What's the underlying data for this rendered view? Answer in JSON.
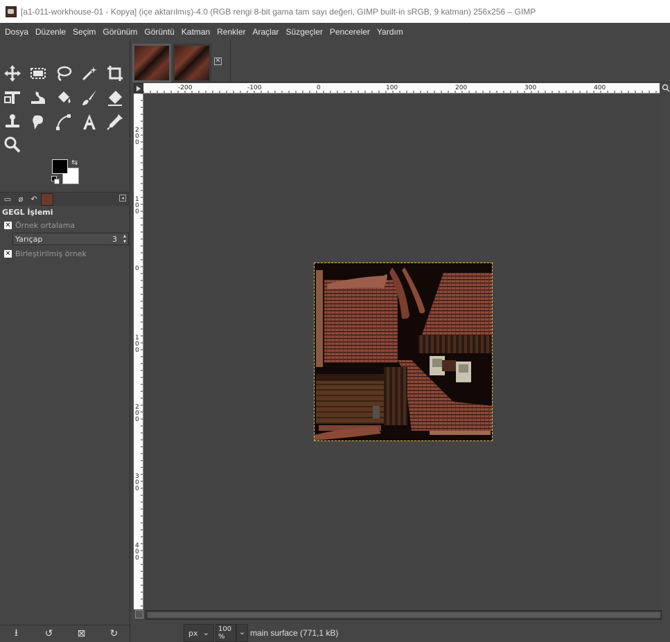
{
  "titlebar": {
    "title": "[a1-011-workhouse-01 - Kopya] (içe aktarılmış)-4.0 (RGB rengi 8-bit gama tam sayı değeri, GIMP built-in sRGB, 9 katman) 256x256 – GIMP"
  },
  "menubar": {
    "items": [
      "Dosya",
      "Düzenle",
      "Seçim",
      "Görünüm",
      "Görüntü",
      "Katman",
      "Renkler",
      "Araçlar",
      "Süzgeçler",
      "Pencereler",
      "Yardım"
    ]
  },
  "toolbox": {
    "tools": [
      "move-icon",
      "rect-select-icon",
      "lasso-icon",
      "fuzzy-select-icon",
      "crop-icon",
      "unified-transform-icon",
      "warp-icon",
      "bucket-fill-icon",
      "paintbrush-icon",
      "eraser-icon",
      "clone-icon",
      "smudge-icon",
      "paths-icon",
      "text-icon",
      "color-picker-icon",
      "zoom-icon"
    ],
    "fg_color": "#000000",
    "bg_color": "#ffffff"
  },
  "tool_options": {
    "title": "GEGL İşlemi",
    "sample_average_label": "Örnek ortalama",
    "radius_label": "Yarıçap",
    "radius_value": "3",
    "sample_merged_label": "Birleştirilmiş örnek"
  },
  "rulers": {
    "horizontal_labels": [
      "-200",
      "-100",
      "0",
      "100",
      "200",
      "300",
      "400"
    ],
    "vertical_labels": [
      "200",
      "100",
      "0",
      "100",
      "200",
      "300",
      "400"
    ]
  },
  "statusbar": {
    "unit": "px",
    "zoom": "100 %",
    "message": "main surface (771,1 kB)"
  },
  "colors": {
    "canvas_bg": "#444444",
    "ui_bg": "#454545",
    "selection_outline": "#d8c040"
  }
}
